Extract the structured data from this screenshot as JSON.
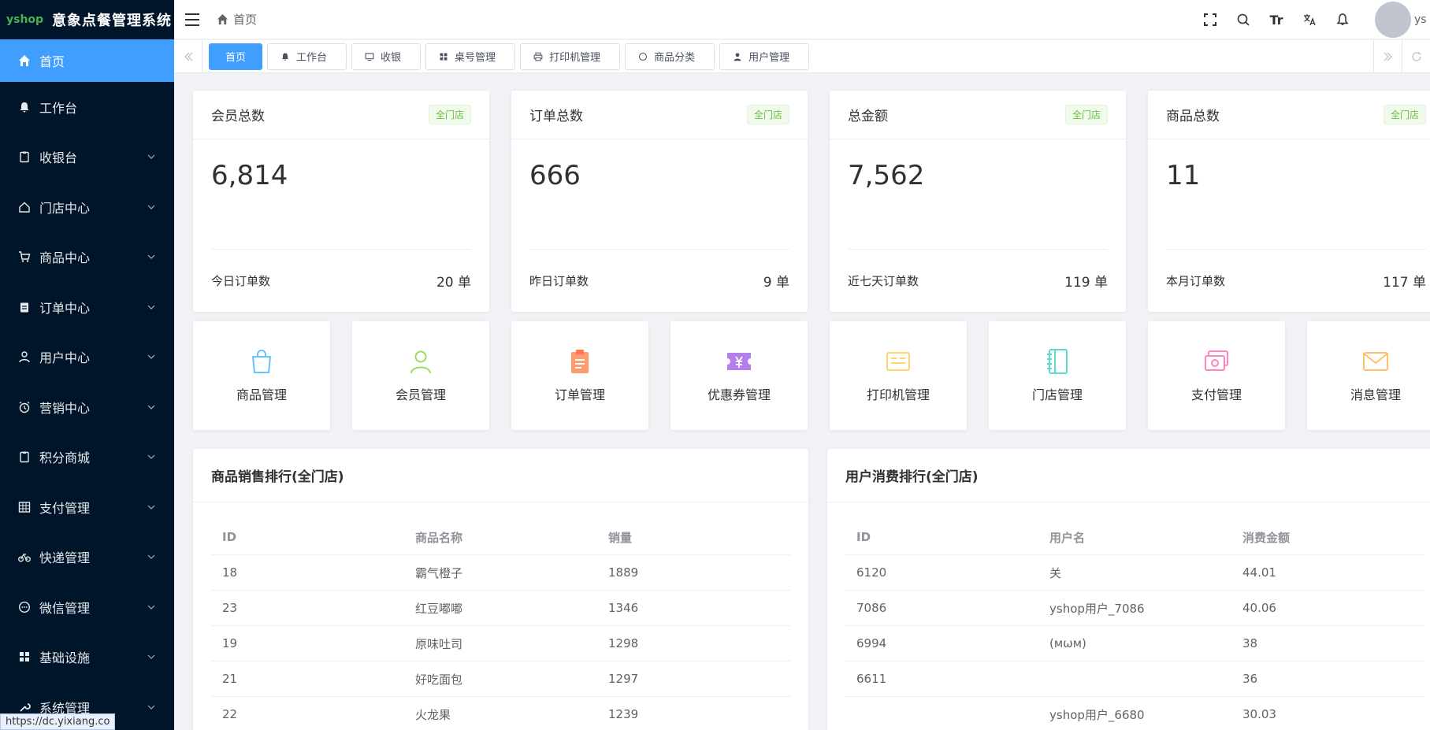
{
  "app": {
    "logo_text": "yshop",
    "title": "意象点餐管理系统"
  },
  "sidebar": {
    "items": [
      {
        "label": "首页",
        "icon": "home-icon",
        "active": true
      },
      {
        "label": "工作台",
        "icon": "bell-icon"
      },
      {
        "label": "收银台",
        "icon": "clipboard-icon"
      },
      {
        "label": "门店中心",
        "icon": "house-outline-icon"
      },
      {
        "label": "商品中心",
        "icon": "cart-icon"
      },
      {
        "label": "订单中心",
        "icon": "order-icon"
      },
      {
        "label": "用户中心",
        "icon": "user-icon"
      },
      {
        "label": "营销中心",
        "icon": "alarm-icon"
      },
      {
        "label": "积分商城",
        "icon": "clipboard-icon"
      },
      {
        "label": "支付管理",
        "icon": "grid-icon"
      },
      {
        "label": "快递管理",
        "icon": "bicycle-icon"
      },
      {
        "label": "微信管理",
        "icon": "chat-icon"
      },
      {
        "label": "基础设施",
        "icon": "apps-icon"
      },
      {
        "label": "系统管理",
        "icon": "wrench-icon"
      }
    ]
  },
  "header": {
    "breadcrumb": "首页",
    "font_size_label": "Tr",
    "username": "ys"
  },
  "tabs": [
    {
      "label": "首页",
      "active": true
    },
    {
      "label": "工作台",
      "icon": "bell-icon"
    },
    {
      "label": "收银",
      "icon": "monitor-icon"
    },
    {
      "label": "桌号管理",
      "icon": "apps-icon"
    },
    {
      "label": "打印机管理",
      "icon": "printer-icon"
    },
    {
      "label": "商品分类",
      "icon": "chat-icon"
    },
    {
      "label": "用户管理",
      "icon": "user-icon"
    }
  ],
  "stats": [
    {
      "title": "会员总数",
      "tag": "全门店",
      "value": "6,814",
      "foot_label": "今日订单数",
      "foot_value": "20 单"
    },
    {
      "title": "订单总数",
      "tag": "全门店",
      "value": "666",
      "foot_label": "昨日订单数",
      "foot_value": "9 单"
    },
    {
      "title": "总金额",
      "tag": "全门店",
      "value": "7,562",
      "foot_label": "近七天订单数",
      "foot_value": "119 单"
    },
    {
      "title": "商品总数",
      "tag": "全门店",
      "value": "11",
      "foot_label": "本月订单数",
      "foot_value": "117 单"
    }
  ],
  "quick_links": [
    {
      "label": "商品管理",
      "icon": "shopping-bag-icon",
      "color": "#69c0ff"
    },
    {
      "label": "会员管理",
      "icon": "member-icon",
      "color": "#95de64"
    },
    {
      "label": "订单管理",
      "icon": "order-clipboard-icon",
      "color": "#ff9c6e"
    },
    {
      "label": "优惠券管理",
      "icon": "coupon-icon",
      "color": "#b37feb"
    },
    {
      "label": "打印机管理",
      "icon": "printer-card-icon",
      "color": "#ffd666"
    },
    {
      "label": "门店管理",
      "icon": "notebook-icon",
      "color": "#5cdbd3"
    },
    {
      "label": "支付管理",
      "icon": "payment-icon",
      "color": "#ff85c0"
    },
    {
      "label": "消息管理",
      "icon": "mail-icon",
      "color": "#ffc069"
    }
  ],
  "product_ranking": {
    "title": "商品销售排行(全门店)",
    "columns": [
      "ID",
      "商品名称",
      "销量"
    ],
    "rows": [
      [
        "18",
        "霸气橙子",
        "1889"
      ],
      [
        "23",
        "红豆嘟嘟",
        "1346"
      ],
      [
        "19",
        "原味吐司",
        "1298"
      ],
      [
        "21",
        "好吃面包",
        "1297"
      ],
      [
        "22",
        "火龙果",
        "1239"
      ]
    ]
  },
  "user_ranking": {
    "title": "用户消费排行(全门店)",
    "columns": [
      "ID",
      "用户名",
      "消费金额"
    ],
    "rows": [
      [
        "6120",
        "关",
        "44.01"
      ],
      [
        "7086",
        "yshop用户_7086",
        "40.06"
      ],
      [
        "6994",
        "(мωм)",
        "38"
      ],
      [
        "6611",
        "",
        "36"
      ],
      [
        "",
        "yshop用户_6680",
        "30.03"
      ]
    ]
  },
  "status_url": "https://dc.yixiang.co",
  "colors": {
    "sidebar_bg": "#001529",
    "accent": "#409eff",
    "tag_green": "#67c23a"
  }
}
